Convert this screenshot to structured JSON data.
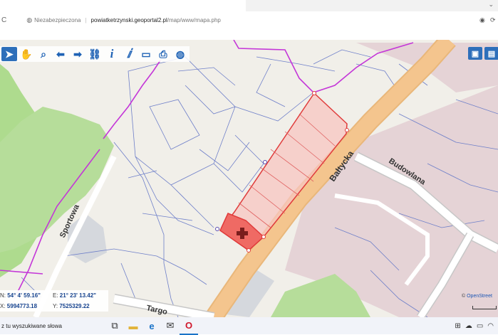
{
  "browser": {
    "collapse_icon": "chevron-down-icon",
    "security_label": "Niezabezpieczona",
    "url_domain": "powiatketrzynski.geoportal2.pl",
    "url_path": "/map/www/mapa.php"
  },
  "toolbar": {
    "tools": [
      "pointer-icon",
      "pan-hand-icon",
      "zoom-icon",
      "arrow-left-icon",
      "arrow-right-icon",
      "link-icon",
      "info-icon",
      "info-area-icon",
      "measure-icon",
      "print-icon",
      "globe-icon"
    ],
    "right_tools": [
      "window-icon",
      "layers-icon"
    ]
  },
  "map": {
    "streets": {
      "baltycka": "Bałtycka",
      "budowlana": "Budowlana",
      "sportowa": "Sportowa",
      "targowa": "Targo"
    },
    "attribution_prefix": "© ",
    "attribution_link": "OpenStreet",
    "colors": {
      "parcel_line": "#6e7fc9",
      "boundary": "#c436d8",
      "selection": "#e03b3b",
      "road": "#f4c58e",
      "green": "#b6dd9a"
    }
  },
  "coords": {
    "n_label": "N:",
    "n_value": "54° 4' 59.16\"",
    "e_label": "E:",
    "e_value": "21° 23' 13.42\"",
    "x_label": "X:",
    "x_value": "5994773.18",
    "y_label": "Y:",
    "y_value": "7525329.22"
  },
  "taskbar": {
    "search_placeholder": "z tu wyszukiwane słowa"
  }
}
